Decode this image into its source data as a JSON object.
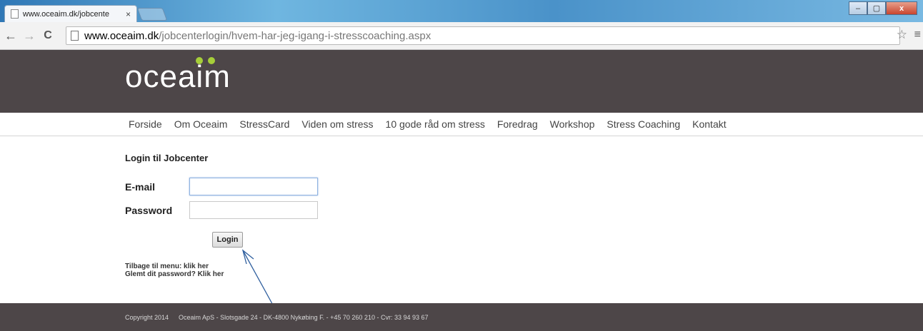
{
  "browser": {
    "tab_title": "www.oceaim.dk/jobcente",
    "tab_close": "×",
    "url_host": "www.oceaim.dk",
    "url_path": "/jobcenterlogin/hvem-har-jeg-igang-i-stresscoaching.aspx",
    "back": "←",
    "forward": "→",
    "reload": "C",
    "star": "☆",
    "menu": "≡",
    "minimize": "–",
    "maximize": "▢",
    "close": "x"
  },
  "header": {
    "logo_text": "oceaim",
    "logo_dot_color": "#a6ce39",
    "background_color": "#4d4648"
  },
  "nav": {
    "items": [
      "Forside",
      "Om Oceaim",
      "StressCard",
      "Viden om stress",
      "10 gode råd om stress",
      "Foredrag",
      "Workshop",
      "Stress Coaching",
      "Kontakt"
    ]
  },
  "login": {
    "title": "Login til Jobcenter",
    "email_label": "E-mail",
    "email_value": "",
    "password_label": "Password",
    "password_value": "",
    "button_label": "Login",
    "back_link": "Tilbage til menu: klik her",
    "forgot_link": "Glemt dit password? Klik her"
  },
  "footer": {
    "copyright": "Copyright 2014",
    "address": "Oceaim ApS - Slotsgade 24 - DK-4800 Nykøbing F. - +45 70 260 210 - Cvr: 33 94 93 67"
  }
}
